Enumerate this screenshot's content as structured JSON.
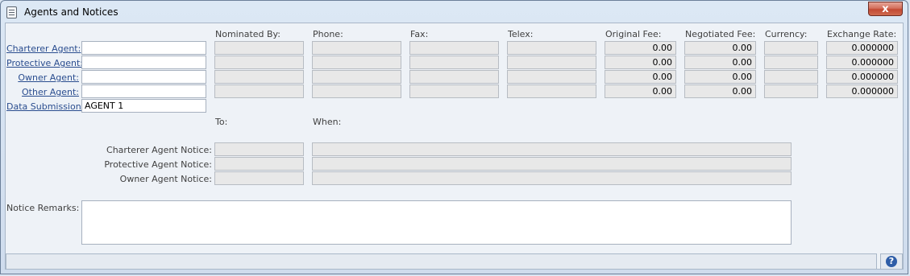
{
  "window": {
    "title": "Agents and Notices",
    "close_glyph": "x"
  },
  "headers": {
    "nominated_by": "Nominated By:",
    "phone": "Phone:",
    "fax": "Fax:",
    "telex": "Telex:",
    "original_fee": "Original Fee:",
    "negotiated_fee": "Negotiated Fee:",
    "currency": "Currency:",
    "exchange_rate": "Exchange Rate:"
  },
  "agents": [
    {
      "label": "Charterer Agent:",
      "value": "",
      "original_fee": "0.00",
      "negotiated_fee": "0.00",
      "exchange_rate": "0.000000"
    },
    {
      "label": "Protective Agent:",
      "value": "",
      "original_fee": "0.00",
      "negotiated_fee": "0.00",
      "exchange_rate": "0.000000"
    },
    {
      "label": "Owner Agent:",
      "value": "",
      "original_fee": "0.00",
      "negotiated_fee": "0.00",
      "exchange_rate": "0.000000"
    },
    {
      "label": "Other Agent:",
      "value": "",
      "original_fee": "0.00",
      "negotiated_fee": "0.00",
      "exchange_rate": "0.000000"
    }
  ],
  "data_submission": {
    "label": "Data Submission:",
    "value": "AGENT 1"
  },
  "notices": {
    "to_header": "To:",
    "when_header": "When:",
    "rows": [
      {
        "label": "Charterer Agent Notice:"
      },
      {
        "label": "Protective Agent Notice:"
      },
      {
        "label": "Owner Agent Notice:"
      }
    ]
  },
  "remarks": {
    "label": "Notice Remarks:",
    "value": ""
  },
  "help": {
    "glyph": "?"
  },
  "colors": {
    "link": "#2a4d8f",
    "close": "#c24a33",
    "readonly": "#e8e8e8",
    "help": "#2f5ea8"
  }
}
